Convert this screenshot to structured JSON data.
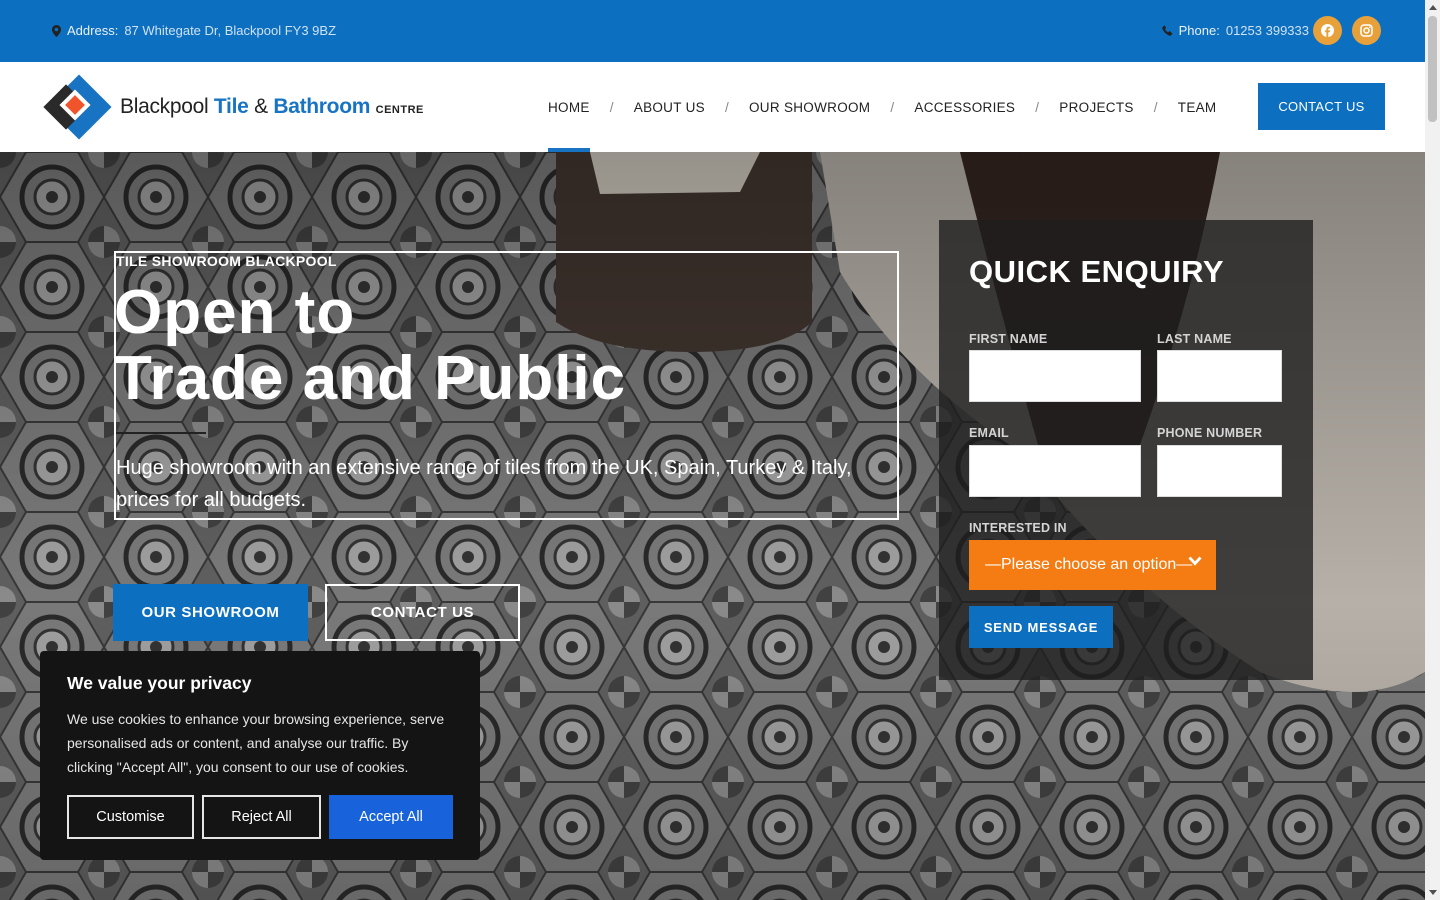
{
  "topbar": {
    "address_label": "Address:",
    "address_value": "87 Whitegate Dr, Blackpool FY3 9BZ",
    "phone_label": "Phone:",
    "phone_value": "01253 399333",
    "socials": [
      "facebook-icon",
      "instagram-icon"
    ],
    "social_color": "#e8a13a"
  },
  "logo": {
    "word1": "Blackpool",
    "word2": "Tile",
    "amp": "&",
    "word3": "Bathroom",
    "word4": "CENTRE"
  },
  "nav": {
    "items": [
      "HOME",
      "ABOUT US",
      "OUR SHOWROOM",
      "ACCESSORIES",
      "PROJECTS",
      "TEAM"
    ],
    "separator": "/",
    "active": "HOME",
    "cta": "CONTACT US"
  },
  "hero": {
    "kicker": "TILE SHOWROOM BLACKPOOL",
    "headline_line1": "Open to",
    "headline_line2": "Trade and Public",
    "lead": "Huge showroom with an extensive range of tiles from the UK, Spain, Turkey & Italy, prices for all budgets.",
    "btn_showroom": "OUR SHOWROOM",
    "btn_contact": "CONTACT US"
  },
  "enquiry": {
    "title": "QUICK ENQUIRY",
    "first_name_label": "FIRST NAME",
    "last_name_label": "LAST NAME",
    "email_label": "EMAIL",
    "phone_label": "PHONE NUMBER",
    "interested_label": "INTERESTED IN",
    "select_value": "—Please choose an option—",
    "send_label": "SEND MESSAGE",
    "first_name_value": "",
    "last_name_value": "",
    "email_value": "",
    "phone_value": ""
  },
  "cookie": {
    "title": "We value your privacy",
    "body": "We use cookies to enhance your browsing experience, serve personalised ads or content, and analyse our traffic. By clicking \"Accept All\", you consent to our use of cookies.",
    "customise": "Customise",
    "reject": "Reject All",
    "accept": "Accept All"
  },
  "colors": {
    "brand_blue": "#0d6fbf",
    "accent_orange": "#f57c13",
    "cookie_accept": "#1863dc"
  }
}
